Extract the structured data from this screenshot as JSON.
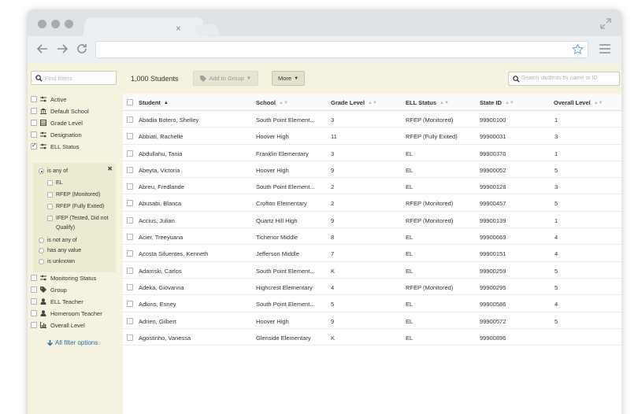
{
  "sidebar": {
    "search_placeholder": "Find filters",
    "filters": [
      {
        "label": "Active",
        "icon": "sliders-icon",
        "checked": false
      },
      {
        "label": "Default School",
        "icon": "building-icon",
        "checked": false
      },
      {
        "label": "Grade Level",
        "icon": "grid-icon",
        "checked": false
      },
      {
        "label": "Designation",
        "icon": "sliders-icon",
        "checked": false
      },
      {
        "label": "ELL Status",
        "icon": "sliders-icon",
        "checked": true
      }
    ],
    "ell_panel": {
      "is_any_of": "is any of",
      "options": [
        "EL",
        "RFEP (Monitored)",
        "RFEP (Fully Exited)",
        "IFEP (Tested, Did not",
        "Qualify)"
      ],
      "is_not_any_of": "is not any of",
      "has_any_value": "has any value",
      "is_unknown": "is unknown"
    },
    "filters_after": [
      {
        "label": "Monitoring Status",
        "icon": "sliders-icon",
        "checked": false
      },
      {
        "label": "Group",
        "icon": "tag-icon",
        "checked": false
      },
      {
        "label": "ELL Teacher",
        "icon": "person-icon",
        "checked": false
      },
      {
        "label": "Homeroom Teacher",
        "icon": "person-icon",
        "checked": false
      },
      {
        "label": "Overall Level",
        "icon": "chart-icon",
        "checked": false
      }
    ],
    "all_filter_options": "All filter options"
  },
  "toolbar": {
    "count": "1,000 Students",
    "add_to_group": "Add to Group",
    "more": "More",
    "search_placeholder": "Search students by name or ID"
  },
  "table": {
    "headers": [
      "Student",
      "School",
      "Grade Level",
      "ELL Status",
      "State ID",
      "Overall Level"
    ],
    "rows": [
      [
        "Abadia Botero, Shelley",
        "South Point Element...",
        "3",
        "RFEP (Monitored)",
        "99900100",
        "1"
      ],
      [
        "Abbiati, Rachelle",
        "Hoover High",
        "11",
        "RFEP (Fully Exited)",
        "99900031",
        "3"
      ],
      [
        "Abdullahu, Tania",
        "Franklin Elementary",
        "3",
        "EL",
        "99900370",
        "1"
      ],
      [
        "Abeyta, Victoria",
        "Hoover High",
        "9",
        "EL",
        "99900052",
        "5"
      ],
      [
        "Abreu, Fredlande",
        "South Point Element...",
        "2",
        "EL",
        "99900128",
        "3"
      ],
      [
        "Abusabi, Blanca",
        "Crofton Elementary",
        "2",
        "RFEP (Monitored)",
        "99900457",
        "5"
      ],
      [
        "Accius, Julian",
        "Quartz Hill High",
        "9",
        "RFEP (Monitored)",
        "99900139",
        "1"
      ],
      [
        "Acier, Treeyuana",
        "Tichenor Middle",
        "8",
        "EL",
        "99900669",
        "4"
      ],
      [
        "Acosta Sifuentes, Kenneth",
        "Jefferson Middle",
        "7",
        "EL",
        "99900151",
        "4"
      ],
      [
        "Adamski, Carlos",
        "South Point Element...",
        "K",
        "EL",
        "99900259",
        "5"
      ],
      [
        "Adeka, Giovanna",
        "Highcrest Elementary",
        "4",
        "RFEP (Monitored)",
        "99900295",
        "5"
      ],
      [
        "Adkins, Esney",
        "South Point Element...",
        "5",
        "EL",
        "99900586",
        "4"
      ],
      [
        "Adrien, Gilbert",
        "Hoover High",
        "9",
        "EL",
        "99900572",
        "5"
      ],
      [
        "Agostinho, Vanessa",
        "Glenside Elementary",
        "K",
        "EL",
        "99900896",
        ""
      ]
    ]
  }
}
